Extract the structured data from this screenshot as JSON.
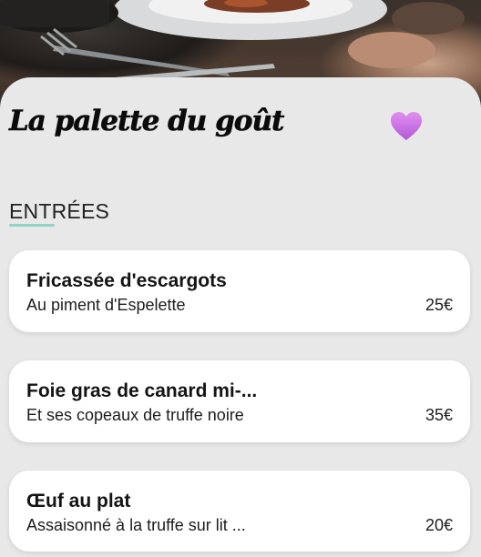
{
  "restaurant": {
    "name": "La palette du goût"
  },
  "colors": {
    "panel_background": "#e8e8e9",
    "accent_underline": "#8fd3c6",
    "favorite_heart_top": "#e28ff0",
    "favorite_heart_bottom": "#b259d6"
  },
  "icons": {
    "favorite": "heart-icon"
  },
  "menu": {
    "section_title": "ENTRÉES",
    "items": [
      {
        "name": "Fricassée d'escargots",
        "description": "Au piment d'Espelette",
        "price": "25€"
      },
      {
        "name": "Foie gras de canard mi-...",
        "description": "Et ses copeaux de truffe noire",
        "price": "35€"
      },
      {
        "name": "Œuf au plat",
        "description": "Assaisonné à la truffe sur lit ...",
        "price": "20€"
      }
    ]
  }
}
